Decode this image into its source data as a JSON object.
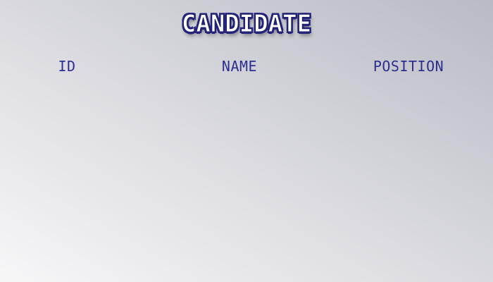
{
  "page": {
    "title": "CANDIDATE"
  },
  "table": {
    "columns": [
      "ID",
      "NAME",
      "POSITION"
    ],
    "rows": []
  },
  "colors": {
    "title_fill": "#ffffff",
    "title_outline": "#24247a",
    "header_text": "#2e2e8f"
  }
}
